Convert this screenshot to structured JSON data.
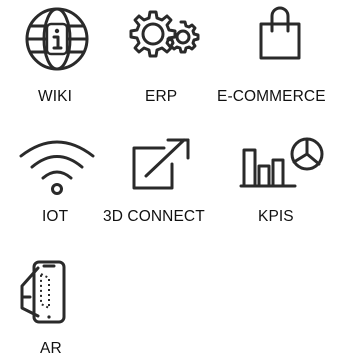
{
  "apps": [
    {
      "label": "WIKI",
      "icon": "globe-info-icon"
    },
    {
      "label": "ERP",
      "icon": "gears-icon"
    },
    {
      "label": "E-COMMERCE",
      "icon": "shopping-bag-icon"
    },
    {
      "label": "IOT",
      "icon": "wifi-icon"
    },
    {
      "label": "3D CONNECT",
      "icon": "external-link-icon"
    },
    {
      "label": "KPIS",
      "icon": "bar-pie-chart-icon"
    },
    {
      "label": "AR",
      "icon": "phone-ar-icon"
    }
  ],
  "colors": {
    "icon": "#2a2a2a",
    "text": "#111111",
    "background": "#ffffff"
  }
}
